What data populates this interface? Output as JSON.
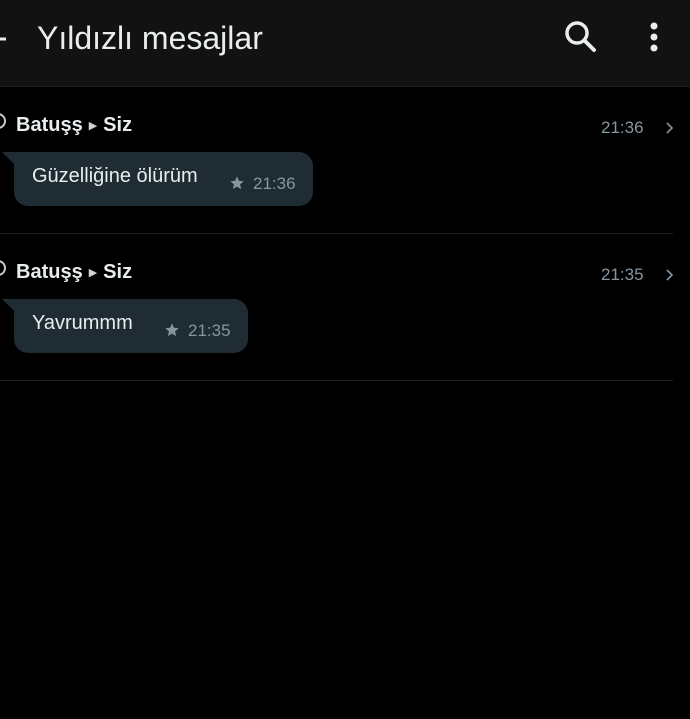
{
  "header": {
    "title": "Yıldızlı mesajlar",
    "back_icon": "arrow-left-icon",
    "search_icon": "search-icon",
    "more_icon": "more-vertical-icon"
  },
  "messages": [
    {
      "sender": "Batuşş",
      "recipient": "Siz",
      "time": "21:36",
      "text": "Güzelliğine ölürüm",
      "bubble_time": "21:36"
    },
    {
      "sender": "Batuşş",
      "recipient": "Siz",
      "time": "21:35",
      "text": "Yavrummm",
      "bubble_time": "21:35"
    }
  ],
  "colors": {
    "background": "#000000",
    "appbar": "#121212",
    "bubble": "#1f2c34",
    "text_primary": "#e9edef",
    "text_secondary": "#8696a0"
  }
}
